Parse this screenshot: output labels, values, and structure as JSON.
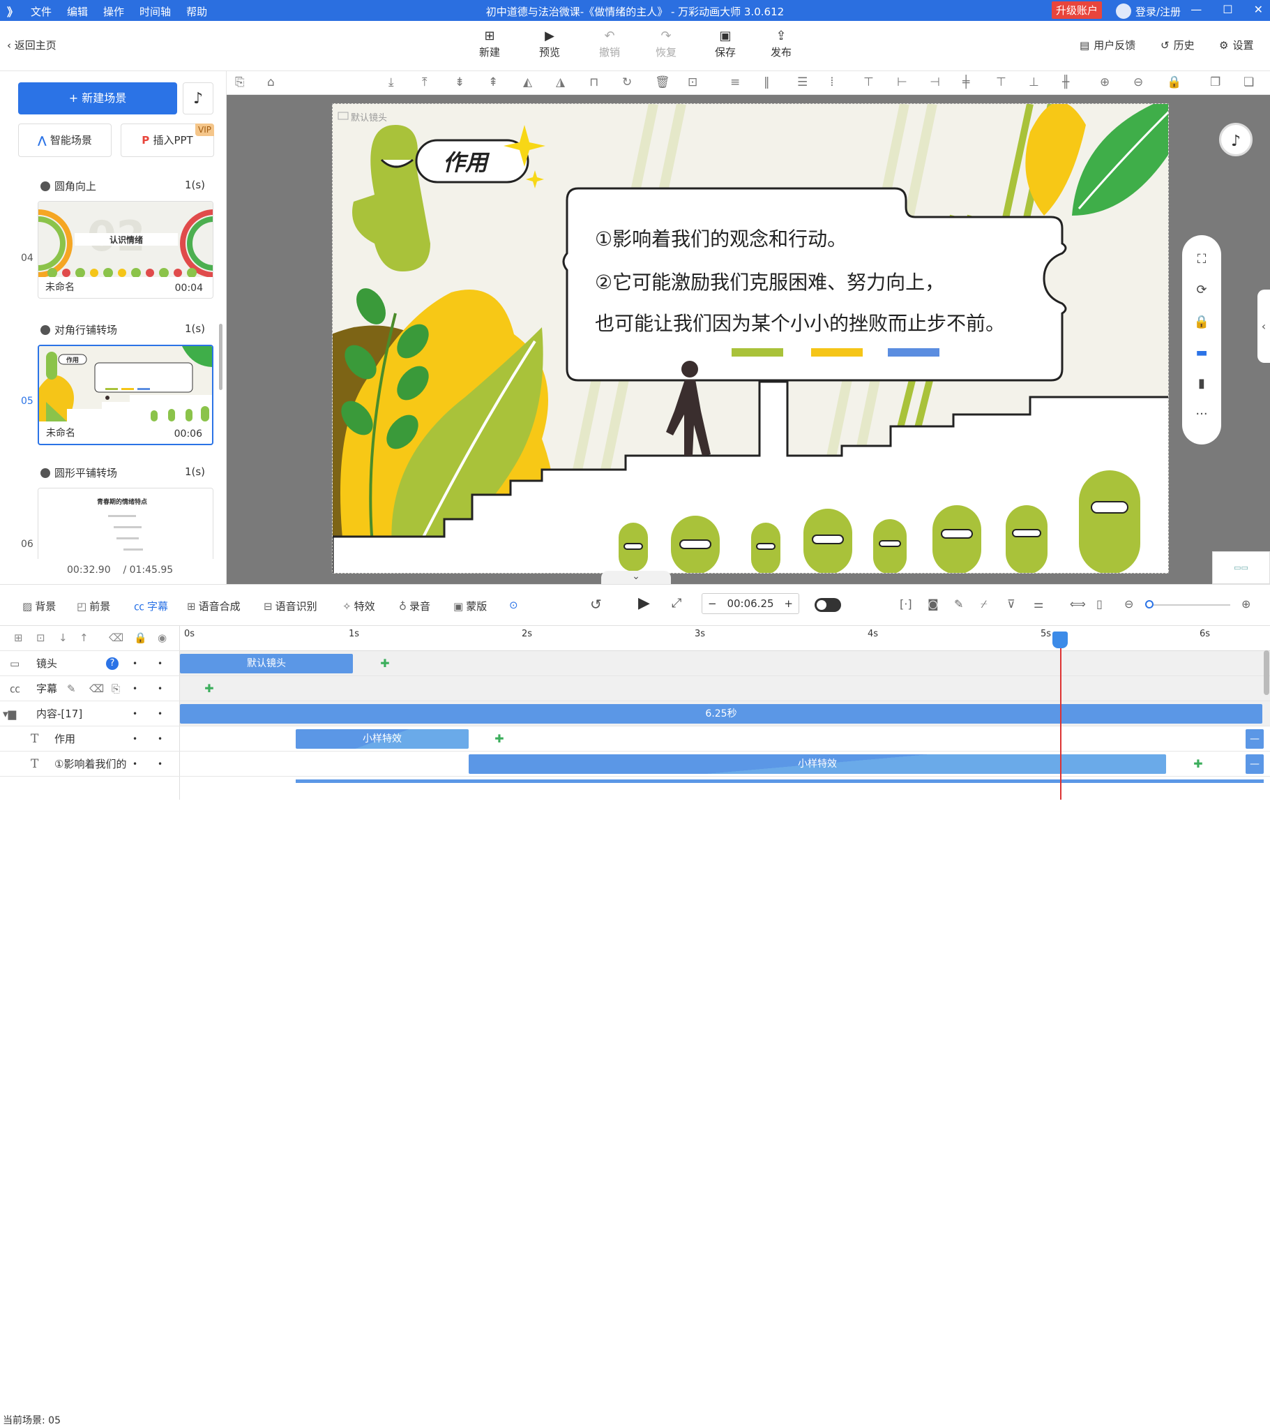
{
  "titlebar": {
    "logo": "》",
    "menu": [
      "文件",
      "编辑",
      "操作",
      "时间轴",
      "帮助"
    ],
    "title": "初中道德与法治微课-《做情绪的主人》 - 万彩动画大师 3.0.612",
    "upgrade": "升级账户",
    "login": "登录/注册",
    "win_min": "—",
    "win_max": "☐",
    "win_close": "✕"
  },
  "toolbar": {
    "back": "返回主页",
    "buttons": [
      {
        "label": "新建",
        "icon": "plus-box-icon"
      },
      {
        "label": "预览",
        "icon": "play-icon"
      },
      {
        "label": "撤销",
        "icon": "undo-icon"
      },
      {
        "label": "恢复",
        "icon": "redo-icon"
      },
      {
        "label": "保存",
        "icon": "save-icon"
      },
      {
        "label": "发布",
        "icon": "publish-icon"
      }
    ],
    "right": {
      "feedback": "用户反馈",
      "history": "历史",
      "settings": "设置"
    }
  },
  "left": {
    "new_scene": "+ 新建场景",
    "smart_scene": "智能场景",
    "insert_ppt": "插入PPT",
    "vip": "VIP",
    "transitions": [
      {
        "name": "圆角向上",
        "dur": "1(s)"
      },
      {
        "name": "对角行铺转场",
        "dur": "1(s)"
      },
      {
        "name": "圆形平铺转场",
        "dur": "1(s)"
      }
    ],
    "scenes": [
      {
        "index": "04",
        "name": "未命名",
        "time": "00:04",
        "thumb_title": "认识情绪"
      },
      {
        "index": "05",
        "name": "未命名",
        "time": "00:06",
        "thumb_title": "作用"
      },
      {
        "index": "06",
        "name": "",
        "time": "",
        "thumb_title": "青春期的情绪特点"
      }
    ],
    "current_time": "00:32.90",
    "total_time": "/ 01:45.95"
  },
  "stage": {
    "camera_label": "默认镜头",
    "heading": "作用",
    "line1": "①影响着我们的观念和行动。",
    "line2": "②它可能激励我们克服困难、努力向上，",
    "line3": "也可能让我们因为某个小小的挫败而止步不前。",
    "bar_colors": [
      "#a9c23a",
      "#f5c518",
      "#5b8de0"
    ]
  },
  "timeline": {
    "tabs": [
      "背景",
      "前景",
      "字幕",
      "语音合成",
      "语音识别",
      "特效",
      "录音",
      "蒙版"
    ],
    "active_tab": "字幕",
    "time_value": "00:06.25",
    "ruler": [
      "0s",
      "1s",
      "2s",
      "3s",
      "4s",
      "5s",
      "6s"
    ],
    "tracks": [
      {
        "name": "镜头",
        "clip": "默认镜头"
      },
      {
        "name": "字幕",
        "clip": ""
      },
      {
        "name": "内容-[17]",
        "clip": "6.25秒"
      },
      {
        "name": "作用",
        "clip": "小样特效"
      },
      {
        "name": "①影响着我们的",
        "clip": "小样特效"
      }
    ],
    "current_scene": "当前场景: 05"
  }
}
